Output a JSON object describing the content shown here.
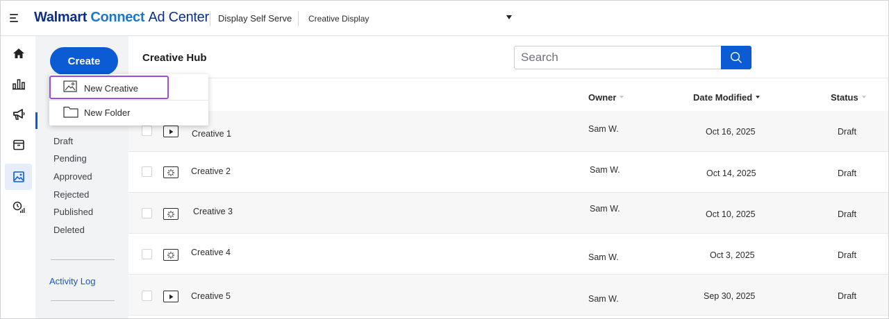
{
  "header": {
    "brand_walmart": "Walmart",
    "brand_connect": "Connect",
    "brand_adcenter": "Ad Center",
    "product": "Display Self Serve",
    "account": "Creative Display"
  },
  "rail": {
    "items": [
      {
        "icon": "home-icon"
      },
      {
        "icon": "bar-chart-icon"
      },
      {
        "icon": "megaphone-icon"
      },
      {
        "icon": "archive-icon"
      },
      {
        "icon": "image-icon",
        "active": true
      },
      {
        "icon": "clock-signal-icon"
      }
    ]
  },
  "subnav": {
    "create_label": "Create",
    "filters": [
      "Draft",
      "Pending",
      "Approved",
      "Rejected",
      "Published",
      "Deleted"
    ],
    "activity_log": "Activity Log"
  },
  "create_menu": {
    "items": [
      {
        "label": "New Creative",
        "icon": "image-frame-icon"
      },
      {
        "label": "New Folder",
        "icon": "folder-icon"
      }
    ]
  },
  "main": {
    "title": "Creative Hub",
    "search_placeholder": "Search",
    "columns": {
      "owner": "Owner",
      "date_modified": "Date Modified",
      "status": "Status"
    },
    "rows": [
      {
        "type": "video",
        "name": "Creative 1",
        "owner": "Sam W.",
        "date": "Oct 16, 2025",
        "status": "Draft"
      },
      {
        "type": "sparkle",
        "name": "Creative 2",
        "owner": "Sam W.",
        "date": "Oct 14, 2025",
        "status": "Draft"
      },
      {
        "type": "sparkle",
        "name": "Creative 3",
        "owner": "Sam W.",
        "date": "Oct 10, 2025",
        "status": "Draft"
      },
      {
        "type": "sparkle",
        "name": "Creative 4",
        "owner": "Sam W.",
        "date": "Oct 3, 2025",
        "status": "Draft"
      },
      {
        "type": "video",
        "name": "Creative 5",
        "owner": "Sam W.",
        "date": "Sep 30, 2025",
        "status": "Draft"
      }
    ]
  },
  "colors": {
    "primary": "#0b5bd4",
    "brand_navy": "#0b2f8a",
    "brand_blue": "#1a76d2",
    "highlight": "#9b4de3"
  }
}
